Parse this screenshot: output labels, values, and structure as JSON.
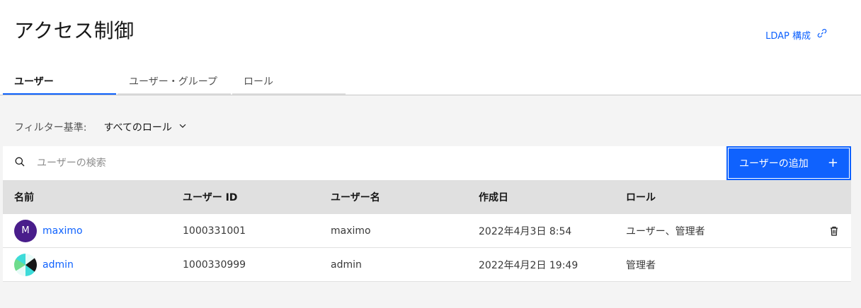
{
  "page": {
    "title": "アクセス制御"
  },
  "ldap": {
    "label": "LDAP 構成",
    "icon": "link-icon"
  },
  "tabs": [
    {
      "label": "ユーザー",
      "active": true
    },
    {
      "label": "ユーザー・グループ",
      "active": false
    },
    {
      "label": "ロール",
      "active": false
    }
  ],
  "filter": {
    "label": "フィルター基準:",
    "value": "すべてのロール"
  },
  "search": {
    "placeholder": "ユーザーの検索",
    "value": ""
  },
  "add_button": {
    "label": "ユーザーの追加",
    "icon": "plus-icon"
  },
  "table": {
    "headers": {
      "name": "名前",
      "user_id": "ユーザー ID",
      "username": "ユーザー名",
      "created": "作成日",
      "role": "ロール"
    },
    "rows": [
      {
        "initial": "M",
        "name": "maximo",
        "user_id": "1000331001",
        "username": "maximo",
        "created": "2022年4月3日 8:54",
        "role": "ユーザー、管理者"
      },
      {
        "initial": "",
        "name": "admin",
        "user_id": "1000330999",
        "username": "admin",
        "created": "2022年4月2日 19:49",
        "role": "管理者"
      }
    ]
  },
  "colors": {
    "accent": "#0f62fe",
    "avatar_purple": "#491d8b",
    "avatar_teal": "#3ddbd9"
  }
}
